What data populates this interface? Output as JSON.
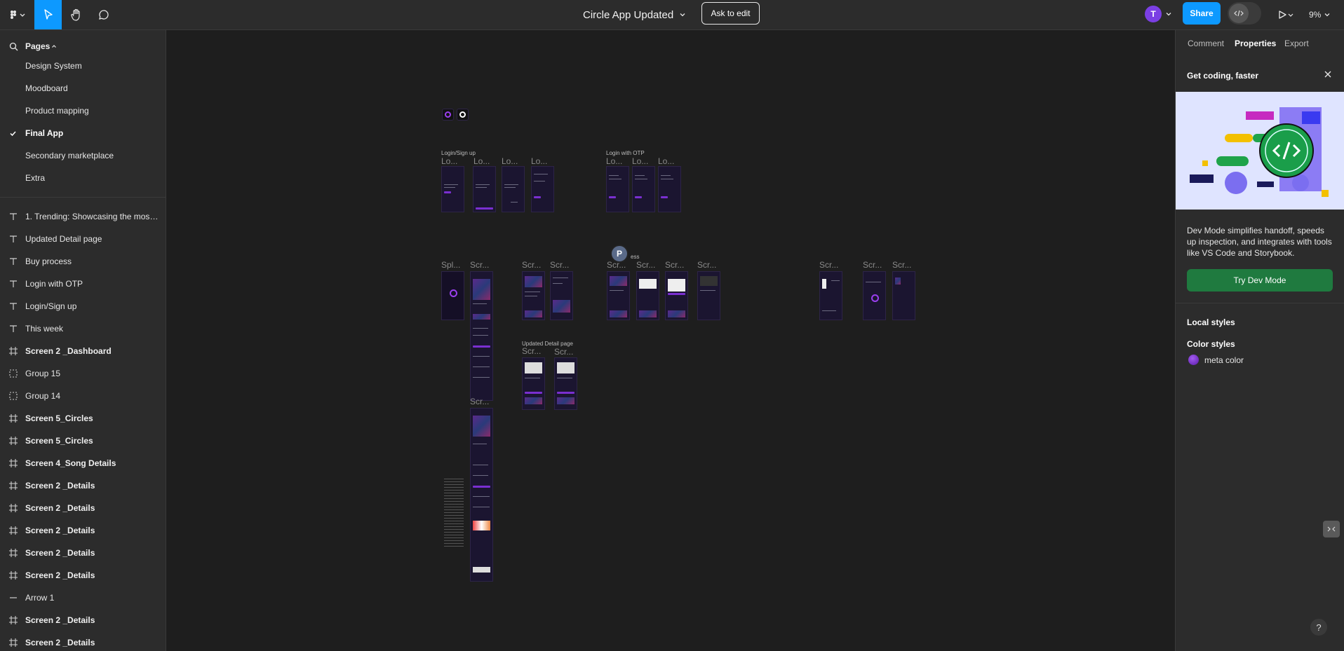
{
  "toolbar": {
    "menu_icon": "figma-logo-icon",
    "move_tool": "move-tool-icon",
    "hand_tool": "hand-tool-icon",
    "comment_tool": "comment-icon",
    "title": "Circle App Updated",
    "ask_to_edit": "Ask to edit",
    "avatar_initial": "T",
    "share": "Share",
    "zoom": "9%"
  },
  "pages": {
    "header": "Pages",
    "items": [
      {
        "label": "Design System",
        "active": false
      },
      {
        "label": "Moodboard",
        "active": false
      },
      {
        "label": "Product mapping",
        "active": false
      },
      {
        "label": "Final App",
        "active": true
      },
      {
        "label": "Secondary marketplace",
        "active": false
      },
      {
        "label": "Extra",
        "active": false
      }
    ]
  },
  "layers": [
    {
      "label": "1. Trending: Showcasing the most …",
      "type": "text"
    },
    {
      "label": "Updated Detail page",
      "type": "text"
    },
    {
      "label": "Buy process",
      "type": "text"
    },
    {
      "label": "Login with OTP",
      "type": "text"
    },
    {
      "label": "Login/Sign up",
      "type": "text"
    },
    {
      "label": "This week",
      "type": "text"
    },
    {
      "label": "Screen 2 _Dashboard",
      "type": "frame"
    },
    {
      "label": "Group 15",
      "type": "group"
    },
    {
      "label": "Group 14",
      "type": "group"
    },
    {
      "label": "Screen 5_Circles",
      "type": "frame"
    },
    {
      "label": "Screen 5_Circles",
      "type": "frame"
    },
    {
      "label": "Screen 4_Song Details",
      "type": "frame"
    },
    {
      "label": "Screen 2 _Details",
      "type": "frame"
    },
    {
      "label": "Screen 2 _Details",
      "type": "frame"
    },
    {
      "label": "Screen 2 _Details",
      "type": "frame"
    },
    {
      "label": "Screen 2 _Details",
      "type": "frame"
    },
    {
      "label": "Screen 2 _Details",
      "type": "frame"
    },
    {
      "label": "Arrow 1",
      "type": "line"
    },
    {
      "label": "Screen 2 _Details",
      "type": "frame"
    },
    {
      "label": "Screen 2 _Details",
      "type": "frame"
    }
  ],
  "canvas": {
    "section_login": "Login/Sign up",
    "section_otp": "Login with OTP",
    "section_updated": "Updated Detail page",
    "section_buy": "ess",
    "frame_lo": "Lo...",
    "frame_scr": "Scr...",
    "frame_spl": "Spl...",
    "cursor_initial": "P"
  },
  "right_panel": {
    "tabs": [
      "Comment",
      "Properties",
      "Export"
    ],
    "active_tab": "Properties",
    "promo_title": "Get coding, faster",
    "promo_text": "Dev Mode simplifies handoff, speeds up inspection, and integrates with tools like VS Code and Storybook.",
    "promo_button": "Try Dev Mode",
    "local_styles": "Local styles",
    "color_styles": "Color styles",
    "color_style_name": "meta color",
    "help": "?"
  },
  "colors": {
    "accent": "#0d99ff",
    "dev_green": "#1f7a3f",
    "meta_color": "#7a2fd0",
    "panel": "#2c2c2c",
    "canvas": "#1e1e1e"
  }
}
